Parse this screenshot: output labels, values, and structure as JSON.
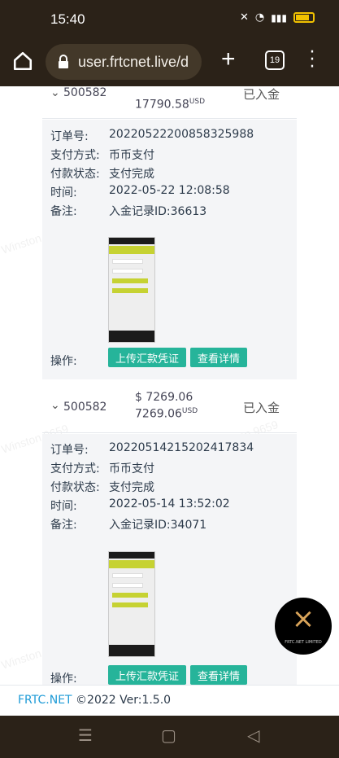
{
  "status_bar": {
    "time": "15:40"
  },
  "browser": {
    "url": "user.frtcnet.live/d",
    "plus": "+",
    "tab_count": "19"
  },
  "records": [
    {
      "id": "500582",
      "amount_top": "",
      "amount_main": "17790.58",
      "currency": "USD",
      "status": "已入金",
      "fields": [
        {
          "label": "订单号:",
          "value": "20220522200858325988"
        },
        {
          "label": "支付方式:",
          "value": "币币支付"
        },
        {
          "label": "付款状态:",
          "value": "支付完成"
        },
        {
          "label": "时间:",
          "value": "2022-05-22 12:08:58"
        },
        {
          "label": "备注:",
          "value": "入金记录ID:36613"
        }
      ],
      "action_label": "操作:",
      "upload_btn": "上传汇款凭证",
      "details_btn": "查看详情"
    },
    {
      "id": "500582",
      "amount_top": "$ 7269.06",
      "amount_main": "7269.06",
      "currency": "USD",
      "status": "已入金",
      "fields": [
        {
          "label": "订单号:",
          "value": "20220514215202417834"
        },
        {
          "label": "支付方式:",
          "value": "币币支付"
        },
        {
          "label": "付款状态:",
          "value": "支付完成"
        },
        {
          "label": "时间:",
          "value": "2022-05-14 13:52:02"
        },
        {
          "label": "备注:",
          "value": "入金记录ID:34071"
        }
      ],
      "action_label": "操作:",
      "upload_btn": "上传汇款凭证",
      "details_btn": "查看详情"
    }
  ],
  "footer": {
    "brand": "FRTC.NET",
    "text": " ©2022 Ver:1.5.0"
  },
  "logo": {
    "text": "FRTC.NET LIMITED"
  },
  "watermark": "Winston 9659"
}
